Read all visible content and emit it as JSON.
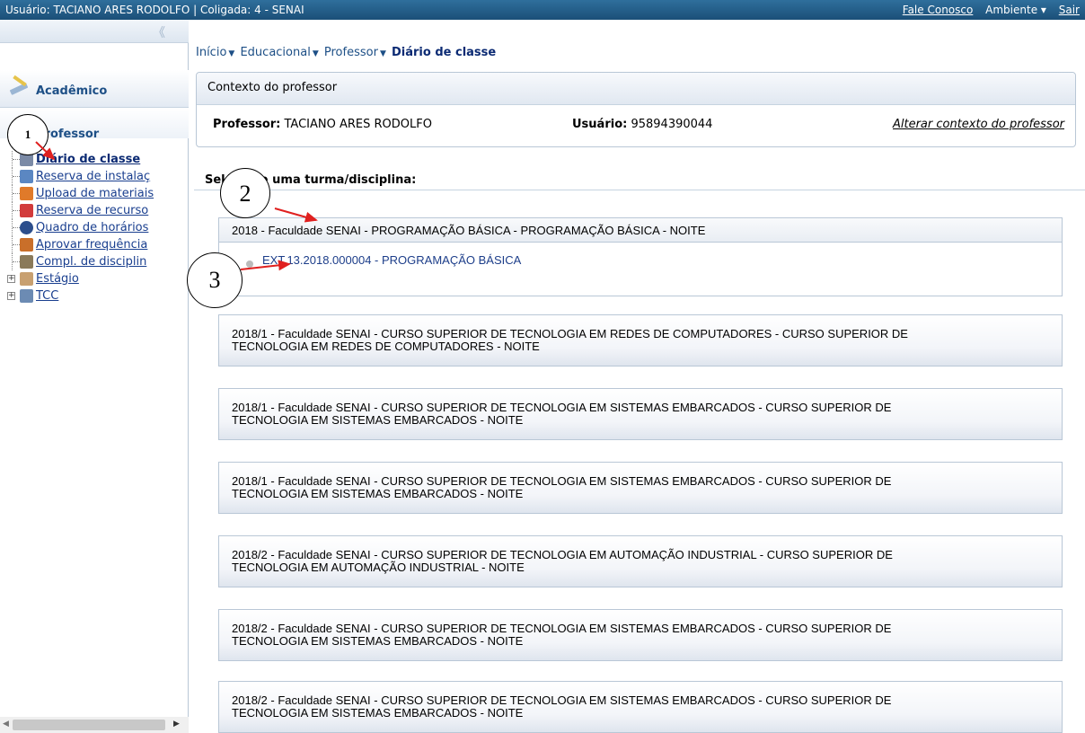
{
  "topbar": {
    "user_info": "Usuário: TACIANO ARES RODOLFO  |  Coligada: 4 - SENAI",
    "contact": "Fale Conosco",
    "environment": "Ambiente ▾",
    "logout": "Sair"
  },
  "sidebar": {
    "collapse_glyph": "《",
    "section_title": "Acadêmico",
    "group_title": "Professor",
    "items": [
      {
        "label": "Diário de classe",
        "icon": "book-icon",
        "color": "#7b8aa6"
      },
      {
        "label": "Reserva de instalaç",
        "icon": "building-icon",
        "color": "#5b87c2"
      },
      {
        "label": "Upload de materiais",
        "icon": "upload-icon",
        "color": "#e07a2a"
      },
      {
        "label": "Reserva de recurso",
        "icon": "checkbox-icon",
        "color": "#d23b3b"
      },
      {
        "label": "Quadro de horários",
        "icon": "clock-icon",
        "color": "#2c4e8c"
      },
      {
        "label": "Aprovar frequência",
        "icon": "approve-icon",
        "color": "#c96f2a"
      },
      {
        "label": "Compl. de disciplin",
        "icon": "scroll-icon",
        "color": "#8a7a5a"
      },
      {
        "label": "Estágio",
        "icon": "person-icon",
        "color": "#c8a070"
      },
      {
        "label": "TCC",
        "icon": "document-icon",
        "color": "#6c8bb3"
      }
    ]
  },
  "breadcrumb": {
    "home": "Início",
    "educational": "Educacional",
    "professor": "Professor",
    "current": "Diário de classe"
  },
  "context": {
    "title": "Contexto do professor",
    "professor_label": "Professor:",
    "professor_value": "TACIANO ARES RODOLFO",
    "user_label": "Usuário:",
    "user_value": "95894390044",
    "change_link": "Alterar contexto do professor"
  },
  "select_heading": "Selecione uma turma/disciplina:",
  "classes": [
    {
      "period": "2018 - Faculdade SENAI - PROGRAMAÇÃO BÁSICA - PROGRAMAÇÃO BÁSICA - NOITE",
      "subject_link": "EXT.13.2018.000004 - PROGRAMAÇÃO BÁSICA"
    },
    {
      "period_line1": "2018/1 - Faculdade SENAI - CURSO SUPERIOR DE TECNOLOGIA EM REDES DE COMPUTADORES - CURSO SUPERIOR DE",
      "period_line2": "TECNOLOGIA EM REDES DE COMPUTADORES - NOITE"
    },
    {
      "period_line1": "2018/1 - Faculdade SENAI - CURSO SUPERIOR DE TECNOLOGIA EM SISTEMAS EMBARCADOS - CURSO SUPERIOR DE",
      "period_line2": "TECNOLOGIA EM SISTEMAS EMBARCADOS - NOITE"
    },
    {
      "period_line1": "2018/1 - Faculdade SENAI - CURSO SUPERIOR DE TECNOLOGIA EM SISTEMAS EMBARCADOS - CURSO SUPERIOR DE",
      "period_line2": "TECNOLOGIA EM SISTEMAS EMBARCADOS - NOITE"
    },
    {
      "period_line1": "2018/2 - Faculdade SENAI - CURSO SUPERIOR DE TECNOLOGIA EM AUTOMAÇÃO INDUSTRIAL - CURSO SUPERIOR DE",
      "period_line2": "TECNOLOGIA EM AUTOMAÇÃO INDUSTRIAL - NOITE"
    },
    {
      "period_line1": "2018/2 - Faculdade SENAI - CURSO SUPERIOR DE TECNOLOGIA EM SISTEMAS EMBARCADOS - CURSO SUPERIOR DE",
      "period_line2": "TECNOLOGIA EM SISTEMAS EMBARCADOS - NOITE"
    },
    {
      "period_line1": "2018/2 - Faculdade SENAI - CURSO SUPERIOR DE TECNOLOGIA EM SISTEMAS EMBARCADOS - CURSO SUPERIOR DE",
      "period_line2": "TECNOLOGIA EM SISTEMAS EMBARCADOS - NOITE"
    }
  ],
  "callouts": {
    "one": "1",
    "two": "2",
    "three": "3"
  },
  "colors": {
    "topbar": "#1b4f78",
    "link": "#1a3f8f",
    "arrow": "#e0201f"
  }
}
